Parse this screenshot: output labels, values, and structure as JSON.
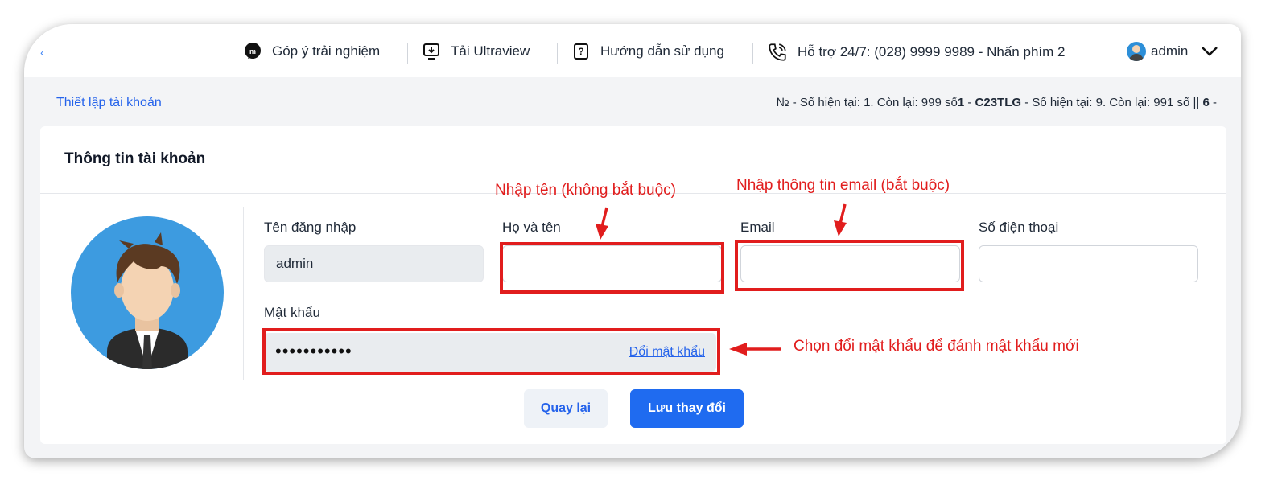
{
  "topbar": {
    "feedback_label": "Góp ý trải nghiệm",
    "ultraview_label": "Tải Ultraview",
    "guide_label": "Hướng dẫn sử dụng",
    "support_label": "Hỗ trợ 24/7: (028) 9999 9989 - Nhấn phím 2",
    "user_name": "admin",
    "icons": [
      "chat-bubble-icon",
      "download-monitor-icon",
      "help-book-icon",
      "phone-icon",
      "user-avatar-icon",
      "chevron-down-icon"
    ]
  },
  "breadcrumb": "Thiết lập tài khoản",
  "ticker": {
    "t1": "№  - Số hiện tại: 1. Còn lại: 999 số",
    "t2": "1",
    "t3": " - ",
    "t4": "C23TLG",
    "t5": "  - Số hiện tại: 9. Còn lại: 991 số",
    "t6": "  ||  ",
    "t7": "6",
    "t8": " -"
  },
  "card": {
    "title": "Thông tin tài khoản",
    "fields": {
      "username_label": "Tên đăng nhập",
      "username_value": "admin",
      "fullname_label": "Họ và tên",
      "fullname_value": "",
      "email_label": "Email",
      "email_value": "",
      "phone_label": "Số điện thoại",
      "phone_value": "",
      "password_label": "Mật khẩu",
      "password_mask": "•••••••••••",
      "change_password_link": "Đổi mật khẩu"
    },
    "buttons": {
      "back": "Quay lại",
      "save": "Lưu thay đổi"
    }
  },
  "annotations": {
    "name_hint": "Nhập tên (không bắt buộc)",
    "email_hint": "Nhập thông tin email (bắt buộc)",
    "password_hint": "Chọn đổi mật khẩu để đánh mật khẩu mới"
  },
  "colors": {
    "primary": "#1f6bf0",
    "link": "#2563eb",
    "annotation_red": "#e11d1d",
    "avatar_bg": "#3d9be0"
  }
}
